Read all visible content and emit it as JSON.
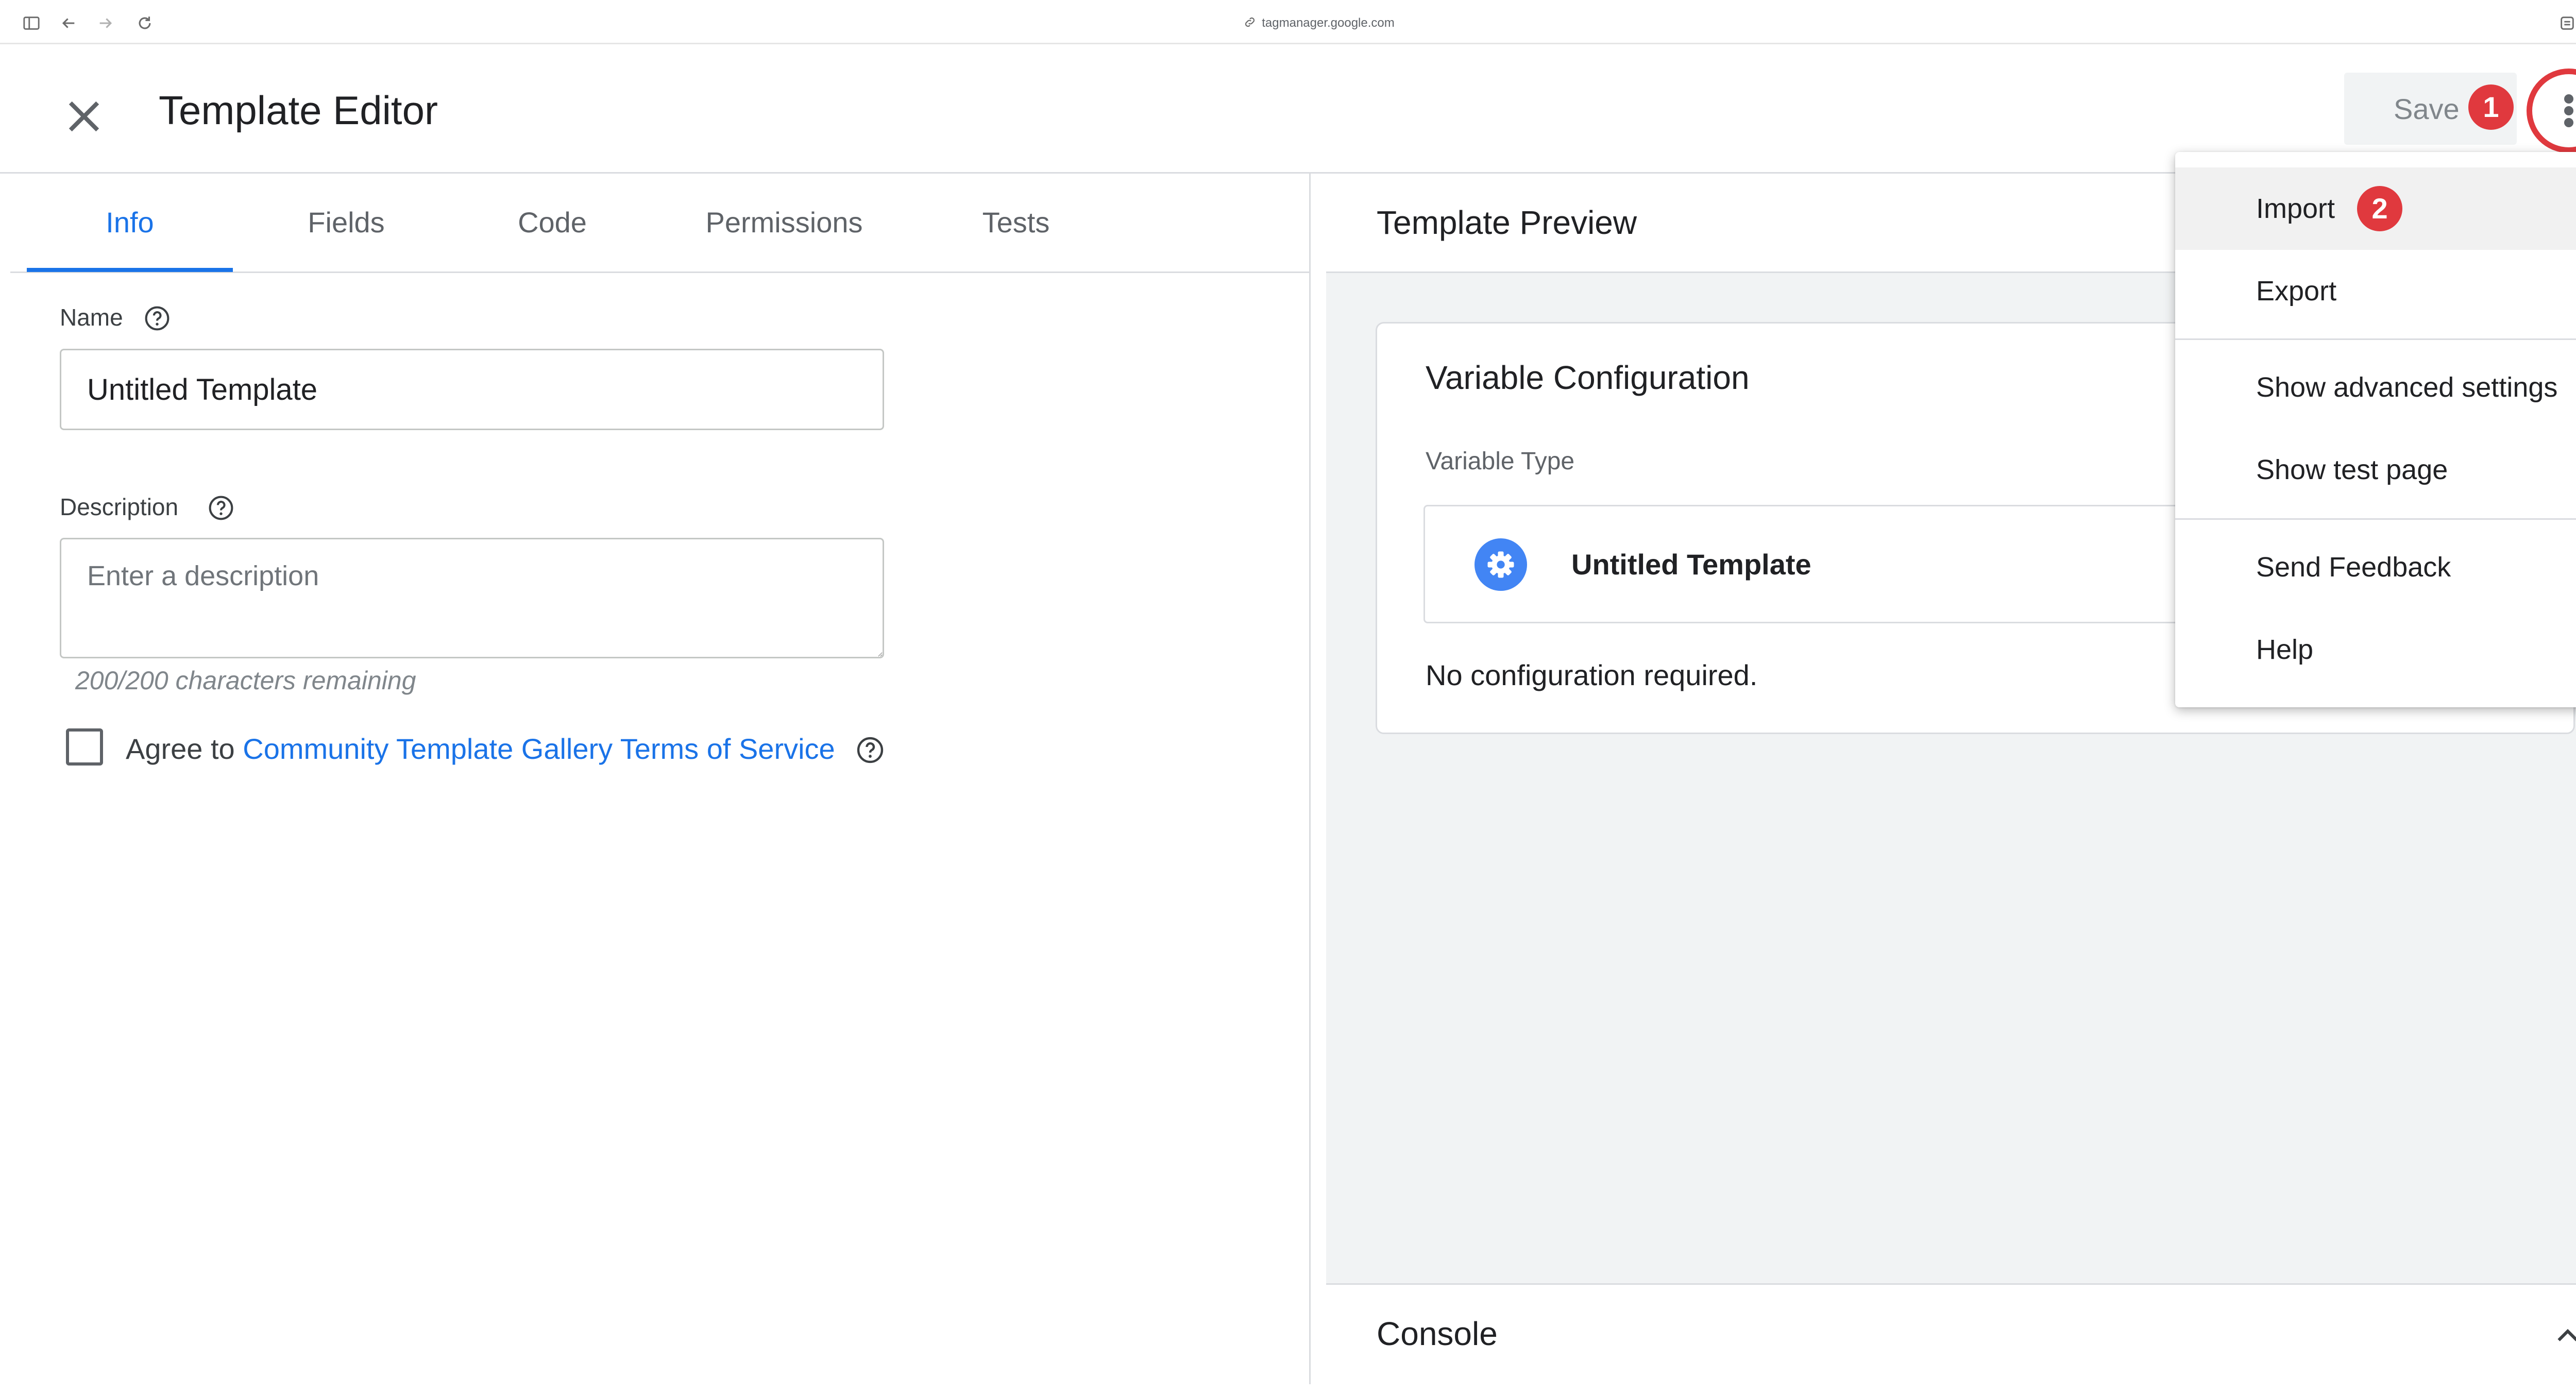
{
  "browser": {
    "url": "tagmanager.google.com"
  },
  "header": {
    "title": "Template Editor",
    "save_label": "Save"
  },
  "annotations": {
    "badge_1": "1",
    "badge_2": "2",
    "color": "#e0393e"
  },
  "tabs": [
    {
      "label": "Info",
      "active": true
    },
    {
      "label": "Fields",
      "active": false
    },
    {
      "label": "Code",
      "active": false
    },
    {
      "label": "Permissions",
      "active": false
    },
    {
      "label": "Tests",
      "active": false
    }
  ],
  "info": {
    "name_label": "Name",
    "name_value": "Untitled Template",
    "description_label": "Description",
    "description_placeholder": "Enter a description",
    "char_count": "200/200 characters remaining",
    "agree_prefix": "Agree to",
    "agree_link": "Community Template Gallery Terms of Service"
  },
  "preview": {
    "title": "Template Preview",
    "card_title": "Variable Configuration",
    "variable_type_label": "Variable Type",
    "variable_type_name": "Untitled Template",
    "no_config": "No configuration required.",
    "console_title": "Console"
  },
  "menu": {
    "items": [
      {
        "label": "Import"
      },
      {
        "label": "Export"
      },
      {
        "label": "Show advanced settings"
      },
      {
        "label": "Show test page"
      },
      {
        "label": "Send Feedback"
      },
      {
        "label": "Help"
      }
    ]
  },
  "colors": {
    "accent": "#1a73e8",
    "gear": "#4285f4"
  }
}
